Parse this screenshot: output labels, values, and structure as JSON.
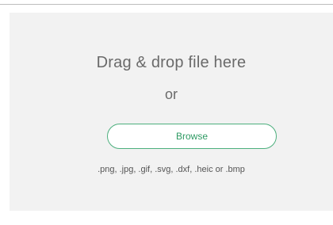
{
  "upload": {
    "heading": "Drag & drop file here",
    "separator": "or",
    "browse_label": "Browse",
    "accepted_formats": ".png, .jpg, .gif, .svg, .dxf, .heic or .bmp"
  },
  "colors": {
    "accent": "#2e9a63",
    "dropzone_background": "#f2f2f2",
    "text": "#6a6a6a"
  }
}
